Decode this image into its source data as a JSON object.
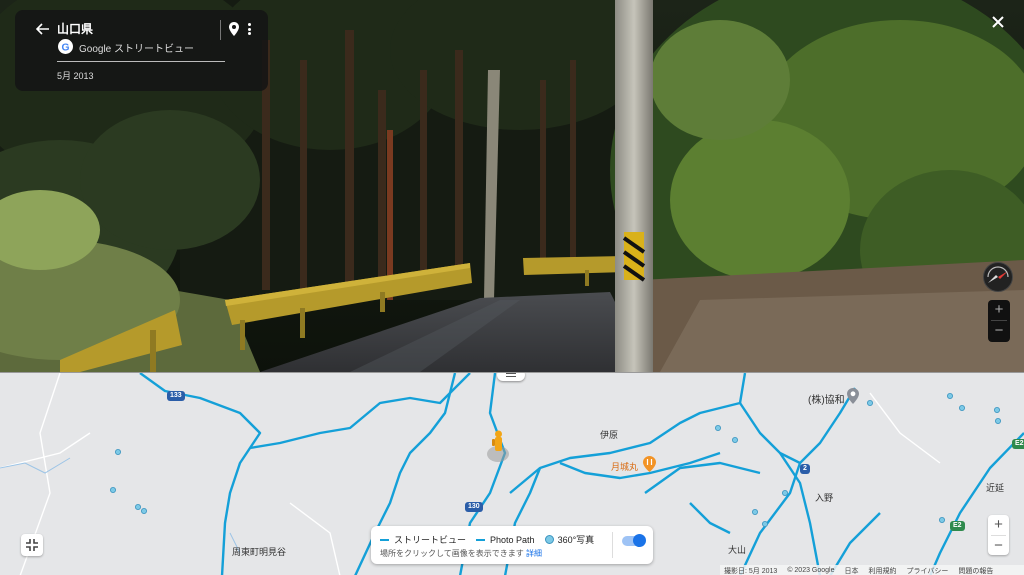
{
  "window": {
    "title": "山口県"
  },
  "info_card": {
    "location": "山口県",
    "provider": "Google ストリートビュー",
    "date": "5月 2013"
  },
  "map": {
    "labels": {
      "company": "(株)協和",
      "iba": "伊原",
      "tsukishiromaru": "月城丸",
      "iriya": "入野",
      "chikaen": "近延",
      "oyama": "大山",
      "suo": "周東町明見谷"
    },
    "road_shields": {
      "r133": "133",
      "r130": "130",
      "r2": "2",
      "e2a": "E2",
      "e2b": "E2"
    },
    "legend": {
      "streetview": "ストリートビュー",
      "photo_path": "Photo Path",
      "photo360": "360°写真",
      "hint": "場所をクリックして画像を表示できます",
      "detail_link": "詳細"
    },
    "zoom_in": "+",
    "zoom_out": "−"
  },
  "pano_zoom": {
    "in": "+",
    "out": "−"
  },
  "footer": {
    "capture_date": "撮影日: 5月 2013",
    "copyright": "© 2023 Google",
    "country": "日本",
    "terms": "利用規約",
    "privacy": "プライバシー",
    "report": "問題の報告"
  },
  "colors": {
    "coverage": "#14a0d8",
    "map_bg": "#e5e6e8",
    "card_bg": "#141414"
  }
}
